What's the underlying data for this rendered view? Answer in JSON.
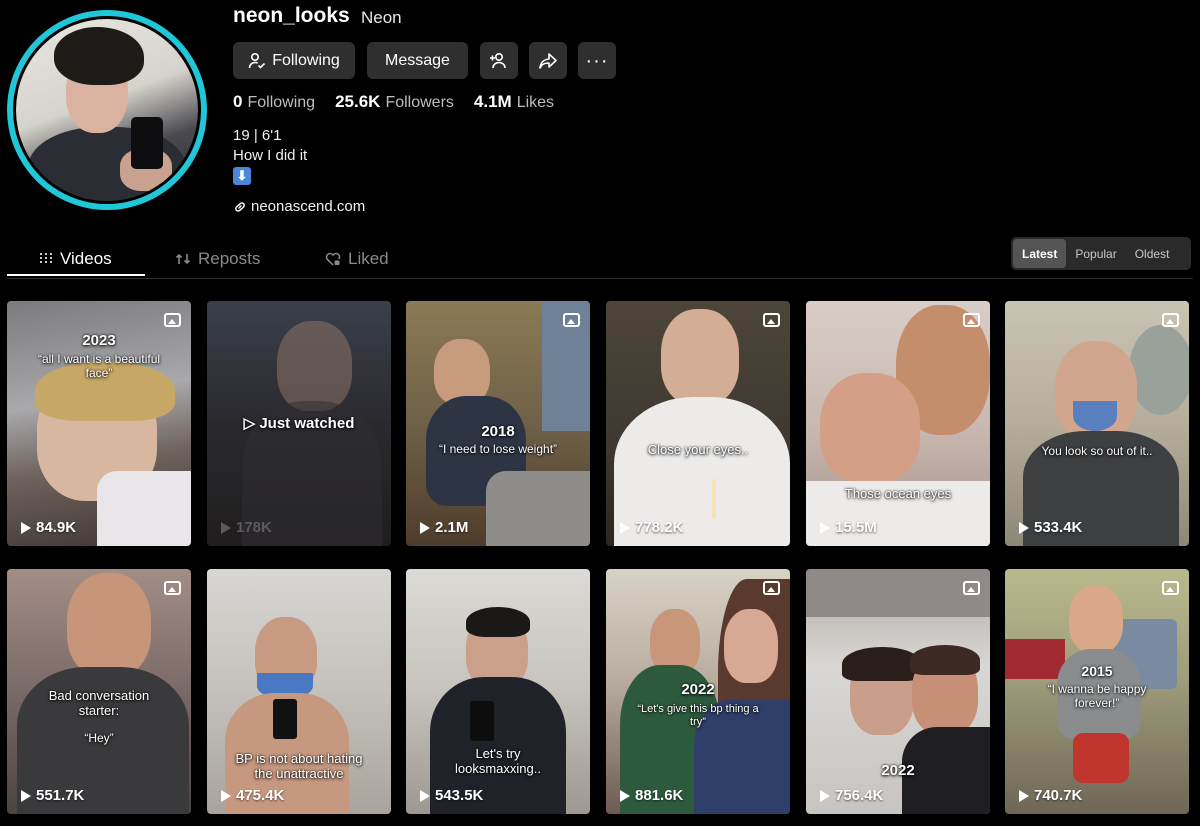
{
  "profile": {
    "username": "neon_looks",
    "nickname": "Neon",
    "buttons": {
      "following": "Following",
      "message": "Message"
    },
    "stats": [
      {
        "value": "0",
        "label": "Following"
      },
      {
        "value": "25.6K",
        "label": "Followers"
      },
      {
        "value": "4.1M",
        "label": "Likes"
      }
    ],
    "bio_line1": "19 | 6'1",
    "bio_line2": "How I did it",
    "bio_emoji": "⬇",
    "link": "neonascend.com",
    "ring_color": "#1fc7d8"
  },
  "tabs": [
    {
      "label": "Videos",
      "icon": "grid-icon",
      "active": true
    },
    {
      "label": "Reposts",
      "icon": "repost-icon",
      "active": false
    },
    {
      "label": "Liked",
      "icon": "heart-lock-icon",
      "active": false
    }
  ],
  "sort": {
    "options": [
      "Latest",
      "Popular",
      "Oldest"
    ],
    "selected": "Latest"
  },
  "videos": [
    {
      "views": "84.9K",
      "caption_title": "2023",
      "caption": "“all I want is a beautiful face”"
    },
    {
      "views": "178K",
      "overlay": "Just watched"
    },
    {
      "views": "2.1M",
      "caption_title": "2018",
      "caption": "“I need to lose weight”"
    },
    {
      "views": "778.2K",
      "caption": "Close your eyes.."
    },
    {
      "views": "15.5M",
      "caption": "Those ocean eyes"
    },
    {
      "views": "533.4K",
      "caption": "You look so out of it.."
    },
    {
      "views": "551.7K",
      "caption": "Bad conversation starter:",
      "caption2": "“Hey”"
    },
    {
      "views": "475.4K",
      "caption": "BP is not about hating the unattractive"
    },
    {
      "views": "543.5K",
      "caption": "Let's try looksmaxxing.."
    },
    {
      "views": "881.6K",
      "caption_title": "2022",
      "caption": "“Let's give this bp thing a try”"
    },
    {
      "views": "756.4K",
      "caption_title": "2022"
    },
    {
      "views": "740.7K",
      "caption_title": "2015",
      "caption": "“I wanna be happy forever!”"
    }
  ]
}
